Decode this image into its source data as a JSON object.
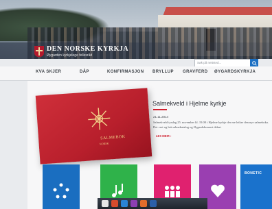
{
  "header": {
    "logo_title": "DEN NORSKE KYRKJA",
    "logo_subtitle": "Øygarden kyrkjelege fellesråd",
    "search_placeholder": "Søk på nettsted..."
  },
  "nav": {
    "items": [
      "KVA SKJER",
      "DÅP",
      "KONFIRMASJON",
      "BRYLLUP",
      "GRAVFERD",
      "ØYGARDSKYRKJA"
    ]
  },
  "article": {
    "title": "Salmekveld i Hjelme kyrkje",
    "date": "21.11.2014",
    "body": "Salmekveld tysdag 25. november kl. 19.00 i Hjelme kyrkje der me leiker den nye salmeboka. Det vert og lett salmekatalog og Øygardskonsert debut.",
    "read_more": "LES MEIR"
  },
  "book": {
    "title_line1": "SALMEBOK",
    "title_line2": "NORSK"
  },
  "tiles": [
    {
      "label": "",
      "color": "#1a6ec0"
    },
    {
      "label": "",
      "color": "#2fb24a"
    },
    {
      "label": "",
      "color": "#e0216f"
    },
    {
      "label": "",
      "color": "#9a3fb1"
    },
    {
      "label": "",
      "color": "#1a6ec0"
    },
    {
      "label": "BONETIC",
      "color": "#1a72cc"
    }
  ],
  "colors": {
    "accent_red": "#d0202f",
    "nav_text": "#3a3f45",
    "search_button": "#1b6fc2"
  }
}
